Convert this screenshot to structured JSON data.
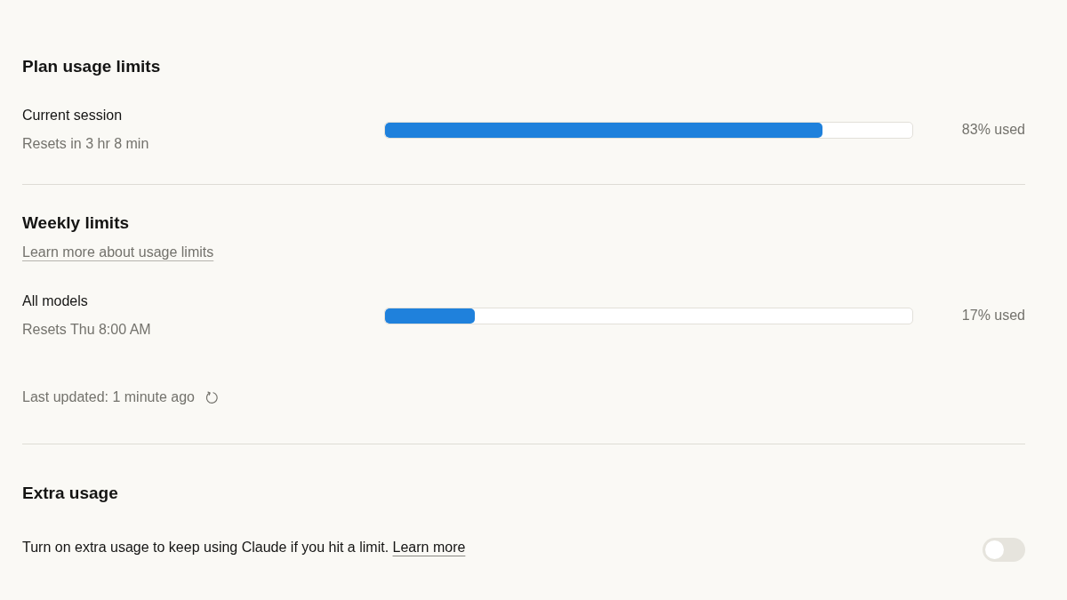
{
  "sections": [
    {
      "title": "Plan usage limits",
      "meters": [
        {
          "name": "Current session",
          "resets": "Resets in 3 hr 8 min",
          "level": 0.83,
          "reading": "83% used"
        }
      ]
    },
    {
      "title": "Weekly limits",
      "link": "Learn more about usage limits",
      "meters": [
        {
          "name": "All models",
          "resets": "Resets Thu 8:00 AM",
          "level": 0.17,
          "reading": "17% used"
        }
      ],
      "last_updated": "Last updated: 1 minute ago"
    },
    {
      "title": "Extra usage",
      "description": "Turn on extra usage to keep using Claude if you hit a limit.",
      "description_link": "Learn more",
      "toggle": {
        "on": false
      }
    }
  ]
}
